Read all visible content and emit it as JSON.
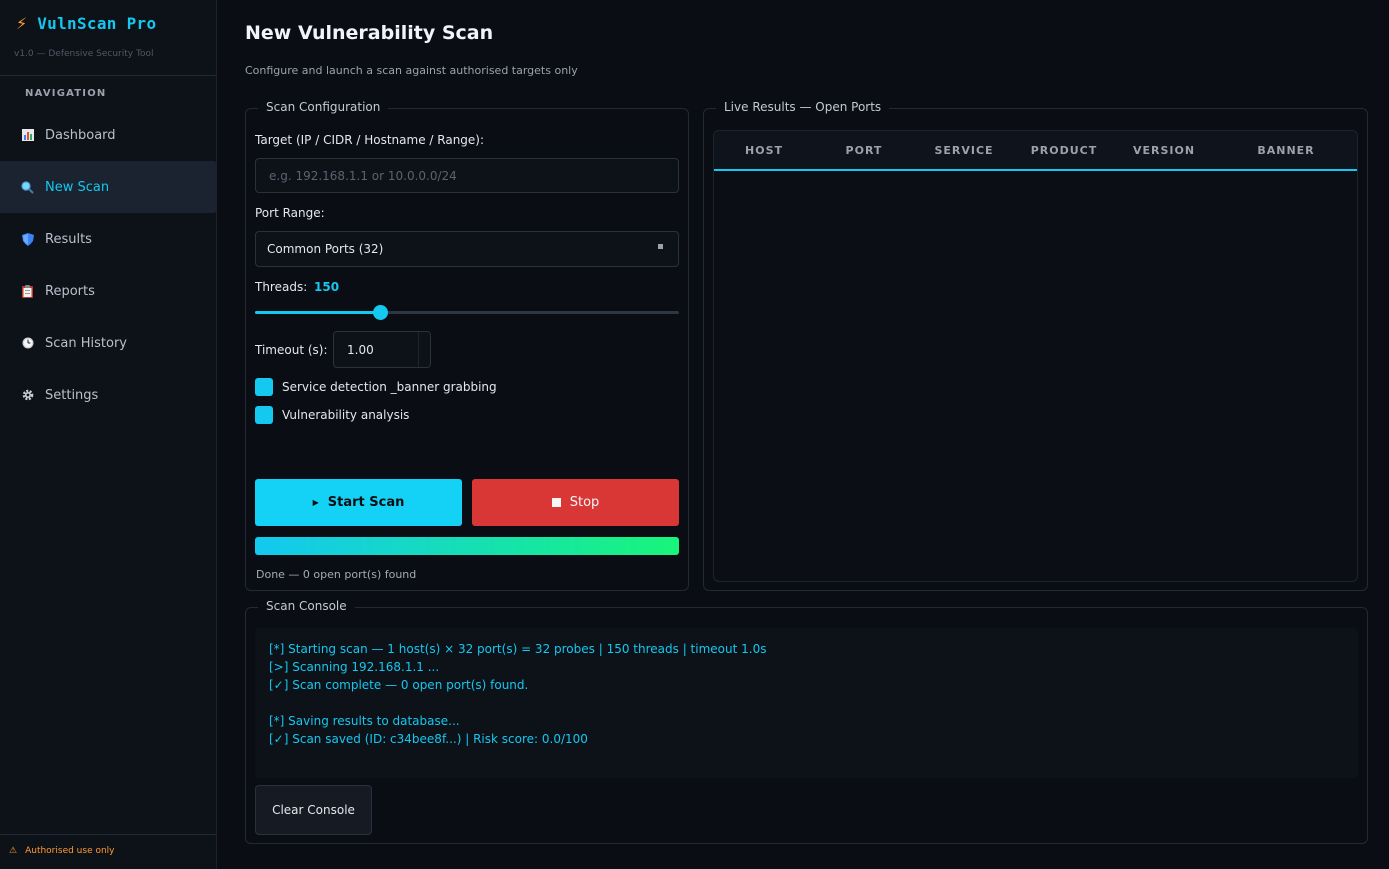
{
  "app": {
    "name": "VulnScan Pro",
    "subtitle": "v1.0  —  Defensive Security Tool",
    "footer": "Authorised use only"
  },
  "sidebar": {
    "header": "NAVIGATION",
    "items": [
      {
        "label": "Dashboard",
        "icon": "chart-icon"
      },
      {
        "label": "New Scan",
        "icon": "magnifier-icon"
      },
      {
        "label": "Results",
        "icon": "shield-icon"
      },
      {
        "label": "Reports",
        "icon": "clipboard-icon"
      },
      {
        "label": "Scan History",
        "icon": "clock-icon"
      },
      {
        "label": "Settings",
        "icon": "gear-icon"
      }
    ],
    "active_index": 1
  },
  "page": {
    "title": "New Vulnerability Scan",
    "subtitle": "Configure and launch a scan against authorised targets only"
  },
  "config": {
    "group_title": "Scan Configuration",
    "target_label": "Target (IP / CIDR / Hostname / Range):",
    "target_value": "",
    "target_placeholder": "e.g. 192.168.1.1 or 10.0.0.0/24",
    "port_range_label": "Port Range:",
    "port_range_value": "Common Ports (32)",
    "threads_label": "Threads:",
    "threads_value": "150",
    "threads_fraction": 0.295,
    "timeout_label": "Timeout (s):",
    "timeout_value": "1.00",
    "service_detection_label": "Service detection _banner grabbing",
    "service_detection_checked": true,
    "vuln_analysis_label": "Vulnerability analysis",
    "vuln_analysis_checked": true,
    "start_label": "Start Scan",
    "stop_label": "Stop",
    "progress_fraction": 1.0,
    "status": "Done — 0 open port(s) found"
  },
  "results": {
    "group_title": "Live Results — Open Ports",
    "columns": [
      "HOST",
      "PORT",
      "SERVICE",
      "PRODUCT",
      "VERSION",
      "BANNER"
    ],
    "rows": []
  },
  "console": {
    "group_title": "Scan Console",
    "lines": [
      "[*] Starting scan — 1 host(s) × 32 port(s) = 32 probes | 150 threads | timeout 1.0s",
      "[>] Scanning 192.168.1.1 ...",
      "[✓] Scan complete — 0 open port(s) found.",
      "",
      "[*] Saving results to database...",
      "[✓] Scan saved (ID: c34bee8f...) | Risk score: 0.0/100"
    ],
    "clear_label": "Clear Console"
  },
  "colors": {
    "accent": "#14c8f0",
    "danger": "#d93636",
    "warning": "#ff9b2f",
    "progress_end": "#18f57a",
    "background": "#0a0d14"
  }
}
